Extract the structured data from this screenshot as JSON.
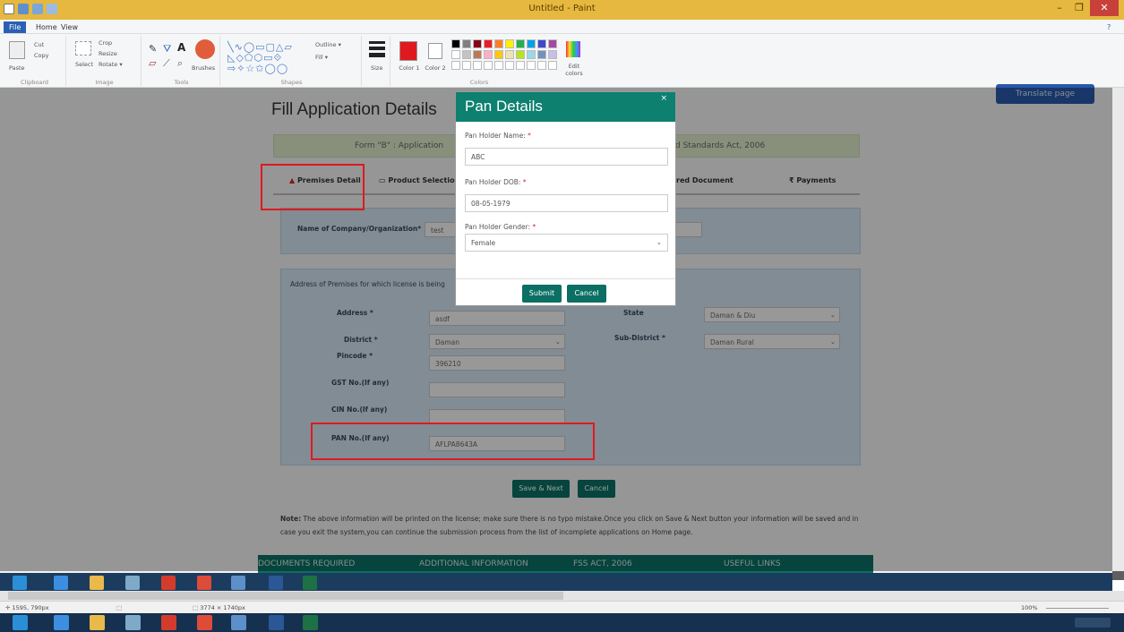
{
  "window": {
    "title": "Untitled - Paint",
    "minimize": "–",
    "maximize": "❐",
    "close": "✕"
  },
  "ribbon": {
    "tabs": [
      "File",
      "Home",
      "View"
    ],
    "clipboard": {
      "paste": "Paste",
      "cut": "Cut",
      "copy": "Copy",
      "label": "Clipboard"
    },
    "image": {
      "select": "Select",
      "crop": "Crop",
      "resize": "Resize",
      "rotate": "Rotate ▾",
      "label": "Image"
    },
    "tools": {
      "label": "Tools",
      "brushes": "Brushes"
    },
    "shapes": {
      "outline": "Outline ▾",
      "fill": "Fill ▾",
      "label": "Shapes"
    },
    "size": "Size",
    "color1": "Color 1",
    "color2": "Color 2",
    "colors_label": "Colors",
    "edit_colors": "Edit colors"
  },
  "page": {
    "translate_button": "Translate page",
    "title": "Fill Application Details",
    "form_banner_left": "Form \"B\" : Application",
    "form_banner_right": "d Standards Act, 2006",
    "steps": [
      "Premises Detail",
      "Product Selection",
      "red Document",
      "₹ Payments"
    ],
    "company_label": "Name of Company/Organization*",
    "company_value": "test",
    "address_section_label": "Address of Premises for which license is being",
    "address_label": "Address *",
    "address_value": "asdf",
    "state_label": "State",
    "state_value": "Daman & Diu",
    "district_label": "District *",
    "district_value": "Daman",
    "subdistrict_label": "Sub-District *",
    "subdistrict_value": "Daman Rural",
    "pincode_label": "Pincode *",
    "pincode_value": "396210",
    "gst_label": "GST No.(If any)",
    "cin_label": "CIN No.(If any)",
    "pan_label": "PAN No.(If any)",
    "pan_value": "AFLPA8643A",
    "save_next": "Save & Next",
    "cancel": "Cancel",
    "note_bold": "Note:",
    "note_text": "The above information will be printed on the license; make sure there is no typo mistake.Once you click on Save & Next button your information will be saved and in case you exit the system,you can continue the submission process from the list of incomplete applications on Home page.",
    "footer_links": [
      "DOCUMENTS REQUIRED",
      "ADDITIONAL INFORMATION",
      "FSS ACT, 2006",
      "USEFUL LINKS"
    ]
  },
  "modal": {
    "title": "Pan Details",
    "close": "×",
    "name_label": "Pan Holder Name:",
    "name_value": "ABC",
    "dob_label": "Pan Holder DOB:",
    "dob_value": "08-05-1979",
    "gender_label": "Pan Holder Gender:",
    "gender_value": "Female",
    "required": "*",
    "submit": "Submit",
    "cancel": "Cancel"
  },
  "status": {
    "cursor_pos": "1595, 790px",
    "size": "3774 × 1740px",
    "zoom": "100%"
  },
  "colors": {
    "accent": "#0d8070",
    "highlight": "#e0191f",
    "titlebar": "#e6b83f"
  }
}
